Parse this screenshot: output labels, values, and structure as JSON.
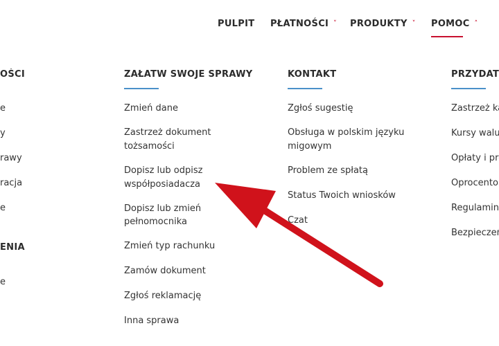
{
  "nav": {
    "items": [
      {
        "label": "PULPIT"
      },
      {
        "label": "PŁATNOŚCI"
      },
      {
        "label": "PRODUKTY"
      },
      {
        "label": "POMOC"
      }
    ]
  },
  "col0": {
    "title": "OŚCI",
    "items": [
      "e",
      "y",
      "rawy",
      "racja",
      "e"
    ],
    "title2": "ENIA",
    "items2": [
      "e"
    ]
  },
  "col1": {
    "title": "ZAŁATW SWOJE SPRAWY",
    "items": [
      "Zmień dane",
      "Zastrzeż dokument",
      "tożsamości",
      "Dopisz lub odpisz",
      "współposiadacza",
      "Dopisz lub zmień",
      "pełnomocnika",
      "Zmień typ rachunku",
      "Zamów dokument",
      "Zgłoś reklamację",
      "Inna sprawa"
    ]
  },
  "col2": {
    "title": "KONTAKT",
    "items": [
      "Zgłoś sugestię",
      "Obsługa w polskim języku",
      "migowym",
      "Problem ze spłatą",
      "Status Twoich wniosków",
      "Czat"
    ]
  },
  "col3": {
    "title": "PRZYDATN",
    "items": [
      "Zastrzeż ka",
      "Kursy walu",
      "Opłaty i pro",
      "Oprocento",
      "Regulaminy",
      "Bezpieczeń"
    ]
  },
  "colors": {
    "accent_red": "#c8102e",
    "rule_blue": "#4a90c9",
    "arrow_red": "#d0121b"
  }
}
